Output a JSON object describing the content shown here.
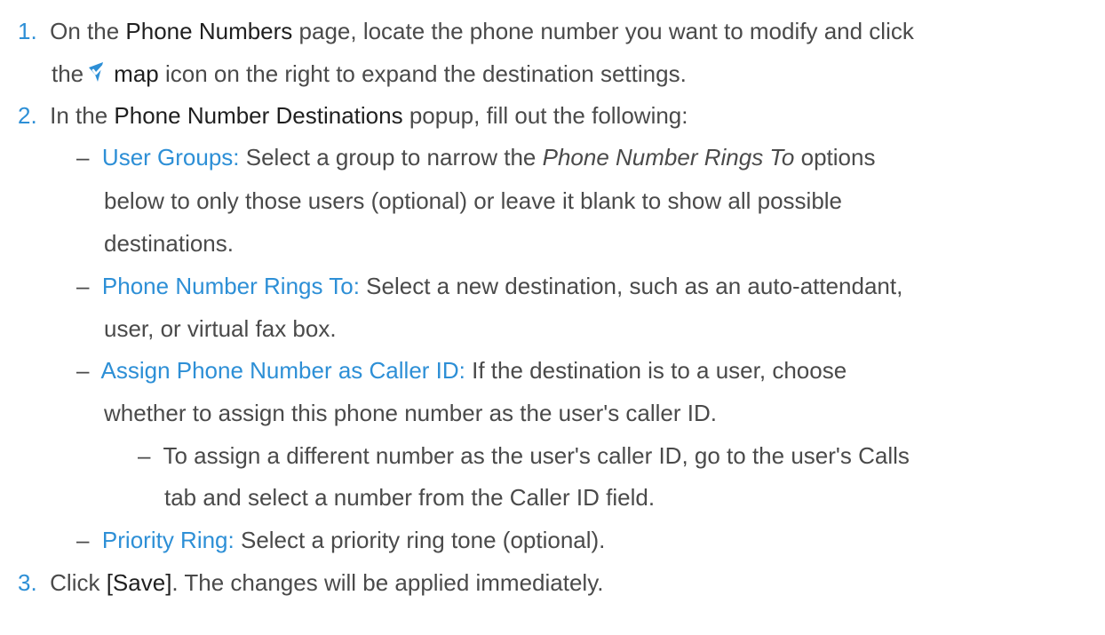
{
  "step1": {
    "number": "1.",
    "t1": "On the ",
    "page_name": "Phone Numbers",
    "t2": " page, locate the phone number you want to modify and click",
    "t3": "the",
    "icon_name": "map",
    "t4": " icon on the right to expand the destination settings."
  },
  "step2": {
    "number": "2.",
    "t1": "In the ",
    "popup_name": "Phone Number Destinations",
    "t2": " popup, fill out the following:",
    "dash": "–",
    "items": [
      {
        "term": "User Groups:",
        "a": " Select a group to narrow the ",
        "em": "Phone Number Rings To",
        "b": " options",
        "c": "below to only those users (optional) or leave it blank to show all possible",
        "d": "destinations."
      },
      {
        "term": "Phone Number Rings To:",
        "a": " Select a new destination, such as an auto-attendant,",
        "b": "user, or virtual fax box."
      },
      {
        "term": "Assign Phone Number as Caller ID:",
        "a": " If the destination is to a user, choose",
        "b": "whether to assign this phone number as the user's caller ID.",
        "sub_a": "To assign a different number as the user's caller ID, go to the user's Calls",
        "sub_b": "tab and select a number from the Caller ID field."
      },
      {
        "term": "Priority Ring:",
        "a": " Select a priority ring tone (optional)."
      }
    ]
  },
  "step3": {
    "number": "3.",
    "t1": "Click ",
    "button": "[Save]",
    "t2": ". The changes will be applied immediately."
  },
  "colors": {
    "accent": "#2d8fd6",
    "text": "#4a4a4a",
    "strong": "#1f1f1f"
  }
}
